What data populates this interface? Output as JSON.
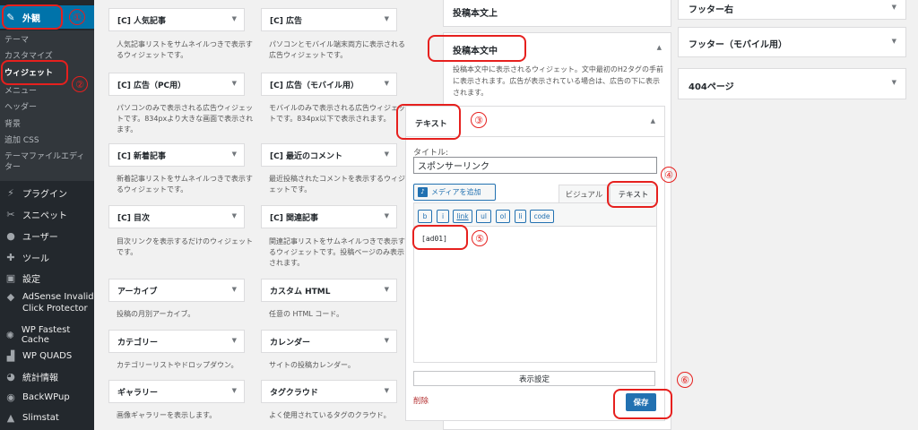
{
  "sidebar": {
    "appearance": "外観",
    "submenu": [
      "テーマ",
      "カスタマイズ",
      "ウィジェット",
      "メニュー",
      "ヘッダー",
      "背景",
      "追加 CSS",
      "テーマファイルエディター"
    ],
    "items": [
      "プラグイン",
      "スニペット",
      "ユーザー",
      "ツール",
      "設定",
      "AdSense Invalid Click Protector",
      "WP Fastest Cache",
      "WP QUADS",
      "統計情報",
      "BackWPup",
      "Slimstat"
    ]
  },
  "widgets": [
    {
      "title": "[C] 人気記事",
      "desc": "人気記事リストをサムネイルつきで表示するウィジェットです。"
    },
    {
      "title": "[C] 広告",
      "desc": "パソコンとモバイル端末両方に表示される広告ウィジェットです。"
    },
    {
      "title": "[C] 広告（PC用）",
      "desc": "パソコンのみで表示される広告ウィジェットです。834pxより大きな画面で表示されます。"
    },
    {
      "title": "[C] 広告（モバイル用）",
      "desc": "モバイルのみで表示される広告ウィジェットです。834px以下で表示されます。"
    },
    {
      "title": "[C] 新着記事",
      "desc": "新着記事リストをサムネイルつきで表示するウィジェットです。"
    },
    {
      "title": "[C] 最近のコメント",
      "desc": "最近投稿されたコメントを表示するウィジェットです。"
    },
    {
      "title": "[C] 目次",
      "desc": "目次リンクを表示するだけのウィジェットです。"
    },
    {
      "title": "[C] 関連記事",
      "desc": "関連記事リストをサムネイルつきで表示するウィジェットです。投稿ページのみ表示されます。"
    },
    {
      "title": "アーカイブ",
      "desc": "投稿の月別アーカイブ。"
    },
    {
      "title": "カスタム HTML",
      "desc": "任意の HTML コード。"
    },
    {
      "title": "カテゴリー",
      "desc": "カテゴリーリストやドロップダウン。"
    },
    {
      "title": "カレンダー",
      "desc": "サイトの投稿カレンダー。"
    },
    {
      "title": "ギャラリー",
      "desc": "画像ギャラリーを表示します。"
    },
    {
      "title": "タグクラウド",
      "desc": "よく使用されているタグのクラウド。"
    }
  ],
  "areas": {
    "above": "投稿本文上",
    "middle": "投稿本文中",
    "middle_desc": "投稿本文中に表示されるウィジェット。文中最初のH2タグの手前に表示されます。広告が表示されている場合は、広告の下に表示されます。",
    "footer_right": "フッター右",
    "footer_mobile": "フッター（モバイル用）",
    "page404": "404ページ"
  },
  "text_widget": {
    "title": "テキスト",
    "field_label": "タイトル:",
    "field_value": "スポンサーリンク",
    "media_button": "メディアを追加",
    "tab_visual": "ビジュアル",
    "tab_text": "テキスト",
    "quicktags": [
      "b",
      "i",
      "link",
      "ul",
      "ol",
      "li",
      "code"
    ],
    "content": "[ad01]",
    "display_settings": "表示設定",
    "delete": "削除",
    "save": "保存"
  },
  "annotations": [
    "①",
    "②",
    "③",
    "④",
    "⑤",
    "⑥"
  ],
  "colors": {
    "accent": "#0073aa",
    "annotation": "#e6201e",
    "sidebar_bg": "#23282d"
  }
}
